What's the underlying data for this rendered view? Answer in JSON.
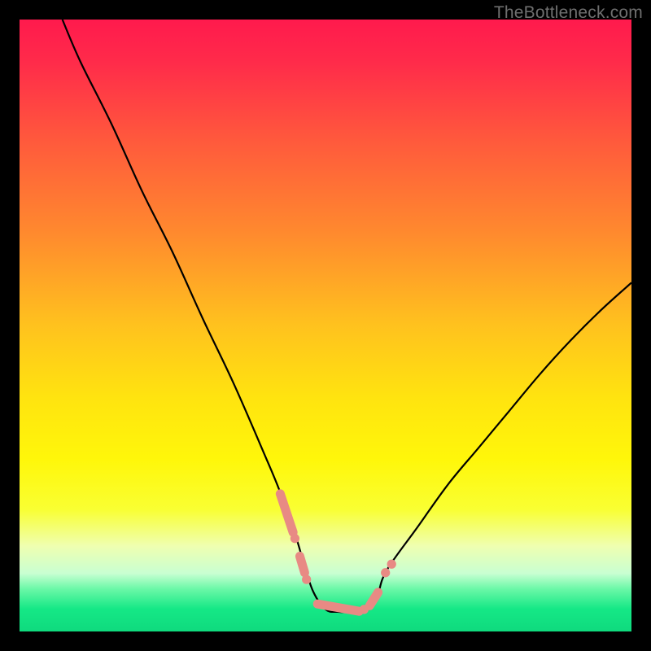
{
  "watermark": "TheBottleneck.com",
  "gradient_stops": [
    {
      "offset": 0.0,
      "color": "#ff1a4d"
    },
    {
      "offset": 0.07,
      "color": "#ff2b4a"
    },
    {
      "offset": 0.2,
      "color": "#ff5a3c"
    },
    {
      "offset": 0.35,
      "color": "#ff8a2e"
    },
    {
      "offset": 0.5,
      "color": "#ffc21e"
    },
    {
      "offset": 0.62,
      "color": "#ffe40f"
    },
    {
      "offset": 0.72,
      "color": "#fff70a"
    },
    {
      "offset": 0.8,
      "color": "#f9ff32"
    },
    {
      "offset": 0.86,
      "color": "#efffb0"
    },
    {
      "offset": 0.905,
      "color": "#c9ffd2"
    },
    {
      "offset": 0.93,
      "color": "#6cf8a8"
    },
    {
      "offset": 0.963,
      "color": "#15e886"
    },
    {
      "offset": 1.0,
      "color": "#0fda7e"
    }
  ],
  "curve_color": "#000000",
  "curve_width": 2.2,
  "marker_color": "#e88a84",
  "chart_data": {
    "type": "line",
    "title": "",
    "xlabel": "",
    "ylabel": "",
    "xlim": [
      0,
      100
    ],
    "ylim": [
      0,
      100
    ],
    "x": [
      7,
      10,
      15,
      20,
      25,
      30,
      35,
      40,
      42.5,
      45,
      46.5,
      48,
      50,
      52,
      54,
      55.5,
      57,
      58.5,
      60,
      65,
      70,
      75,
      80,
      85,
      90,
      95,
      100
    ],
    "values": [
      100,
      93,
      83,
      72,
      62,
      51,
      40.5,
      29,
      23,
      16,
      11,
      6.5,
      3.6,
      3.2,
      3.2,
      3.4,
      4.0,
      6.0,
      10,
      17,
      24,
      30,
      36,
      42,
      47.5,
      52.5,
      57
    ],
    "markers": [
      {
        "x": 42.6,
        "y": 22.5,
        "kind": "segment",
        "x2": 44.7,
        "y2": 16.2
      },
      {
        "x": 45.0,
        "y": 15.2,
        "kind": "dot"
      },
      {
        "x": 45.8,
        "y": 12.3,
        "kind": "segment",
        "x2": 46.6,
        "y2": 9.6
      },
      {
        "x": 46.9,
        "y": 8.5,
        "kind": "dot"
      },
      {
        "x": 48.7,
        "y": 4.5,
        "kind": "segment",
        "x2": 55.5,
        "y2": 3.3
      },
      {
        "x": 56.3,
        "y": 3.6,
        "kind": "dot"
      },
      {
        "x": 57.2,
        "y": 4.2,
        "kind": "segment",
        "x2": 58.6,
        "y2": 6.4
      },
      {
        "x": 59.8,
        "y": 9.6,
        "kind": "dot"
      },
      {
        "x": 60.8,
        "y": 11.0,
        "kind": "dot"
      }
    ]
  }
}
